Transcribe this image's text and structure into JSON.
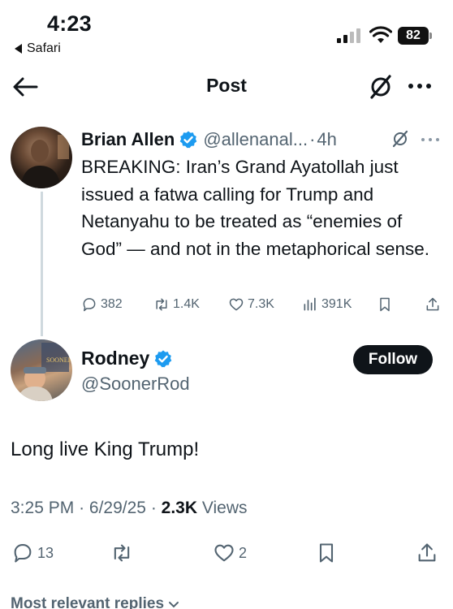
{
  "status_bar": {
    "time": "4:23",
    "back_app": "Safari",
    "battery": "82"
  },
  "header": {
    "title": "Post"
  },
  "parent_tweet": {
    "name": "Brian Allen",
    "handle": "@allenanal...",
    "separator": "·",
    "time": "4h",
    "text": "BREAKING: Iran’s Grand Ayatollah just issued a fatwa calling for Trump and Netanyahu to be treated as “enemies of God” — and not in the metaphorical sense.",
    "replies": "382",
    "reposts": "1.4K",
    "likes": "7.3K",
    "views": "391K"
  },
  "main_tweet": {
    "name": "Rodney",
    "handle": "@SoonerRod",
    "follow_label": "Follow",
    "text": "Long live King Trump!",
    "time": "3:25 PM",
    "date": "6/29/25",
    "dot": "·",
    "views_count": "2.3K",
    "views_label": "Views",
    "replies": "13",
    "likes": "2"
  },
  "replies_sort": {
    "label": "Most relevant replies"
  },
  "colors": {
    "verified_blue": "#1d9bf0",
    "secondary_text": "#536471",
    "primary_text": "#0f1419",
    "follow_bg": "#0f1419"
  }
}
